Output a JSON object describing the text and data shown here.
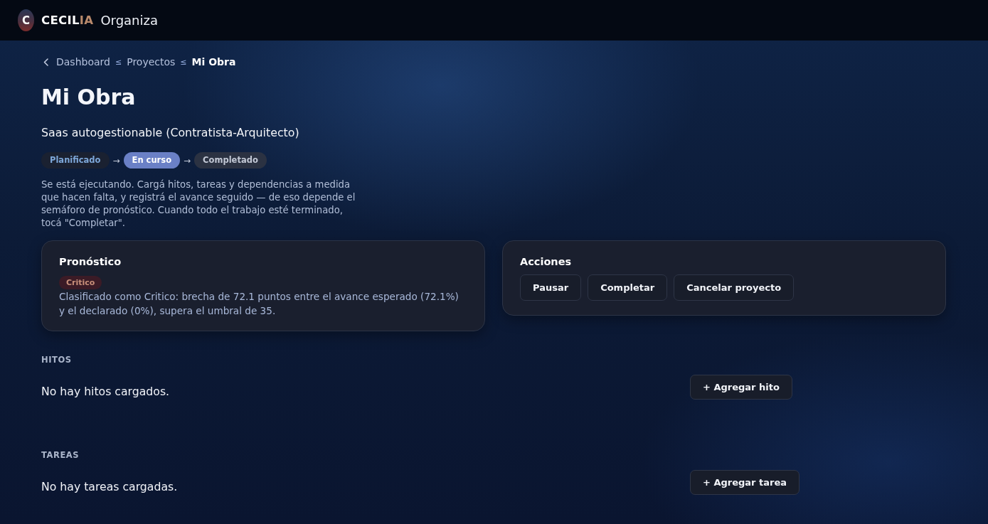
{
  "header": {
    "logo_letter": "C",
    "brand_name": "CECIL",
    "brand_accent": "IA",
    "brand_suffix": "Organiza"
  },
  "breadcrumb": [
    {
      "label": "Dashboard",
      "current": false,
      "separator": "≤"
    },
    {
      "label": "Proyectos",
      "current": false,
      "separator": "≤"
    },
    {
      "label": "Mi Obra",
      "current": true
    }
  ],
  "title": "Mi Obra",
  "subtitle": "Saas autogestionable (Contratista-Arquitecto)",
  "status_steps": [
    {
      "label": "Planificado",
      "selected": false,
      "done": true
    },
    {
      "arrow": "→",
      "label": "En curso",
      "selected": true,
      "done": false
    },
    {
      "arrow": "→",
      "label": "Completado",
      "selected": false,
      "done": false
    }
  ],
  "description": "Se está ejecutando. Cargá hitos, tareas y dependencias a medida que hacen falta, y registrá el avance seguido — de eso depende el semáforo de pronóstico. Cuando todo el trabajo esté terminado, tocá \"Completar\".",
  "forecast": {
    "title": "Pronóstico",
    "badge": {
      "label": "Critico",
      "kind": "critical"
    },
    "text": "Clasificado como Critico: brecha de 72.1 puntos entre el avance esperado (72.1%) y el declarado (0%), supera el umbral de 35."
  },
  "actions": {
    "title": "Acciones",
    "buttons": [
      "Pausar",
      "Completar",
      "Cancelar proyecto"
    ]
  },
  "sections": [
    {
      "heading": "HITOS",
      "empty_text": "No hay hitos cargados.",
      "button": "+ Agregar hito"
    },
    {
      "heading": "TAREAS",
      "empty_text": "No hay tareas cargadas.",
      "button": "+ Agregar tarea"
    }
  ]
}
